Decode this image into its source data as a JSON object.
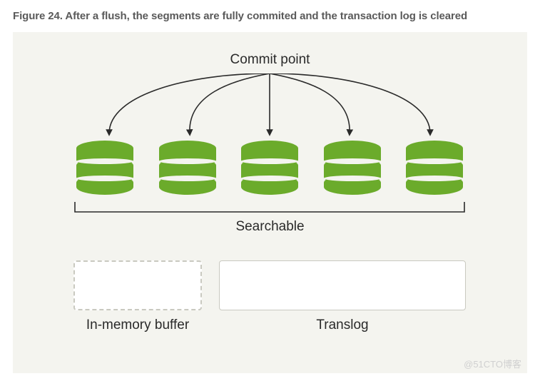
{
  "figure": {
    "title": "Figure 24. After a flush, the segments are fully commited and the transaction log is cleared"
  },
  "labels": {
    "commit_point": "Commit point",
    "searchable": "Searchable",
    "in_memory_buffer": "In-memory buffer",
    "translog": "Translog"
  },
  "segments": {
    "count": 5,
    "color": "#6bab2b"
  },
  "watermark": "@51CTO博客",
  "chart_data": {
    "type": "diagram",
    "description": "Elasticsearch flush operation state",
    "nodes": [
      {
        "id": "commit_point",
        "label": "Commit point"
      },
      {
        "id": "seg1",
        "type": "segment",
        "state": "committed_searchable"
      },
      {
        "id": "seg2",
        "type": "segment",
        "state": "committed_searchable"
      },
      {
        "id": "seg3",
        "type": "segment",
        "state": "committed_searchable"
      },
      {
        "id": "seg4",
        "type": "segment",
        "state": "committed_searchable"
      },
      {
        "id": "seg5",
        "type": "segment",
        "state": "committed_searchable"
      },
      {
        "id": "in_memory_buffer",
        "label": "In-memory buffer",
        "state": "empty"
      },
      {
        "id": "translog",
        "label": "Translog",
        "state": "cleared"
      }
    ],
    "edges": [
      {
        "from": "commit_point",
        "to": "seg1"
      },
      {
        "from": "commit_point",
        "to": "seg2"
      },
      {
        "from": "commit_point",
        "to": "seg3"
      },
      {
        "from": "commit_point",
        "to": "seg4"
      },
      {
        "from": "commit_point",
        "to": "seg5"
      }
    ],
    "groups": [
      {
        "label": "Searchable",
        "members": [
          "seg1",
          "seg2",
          "seg3",
          "seg4",
          "seg5"
        ]
      }
    ]
  }
}
